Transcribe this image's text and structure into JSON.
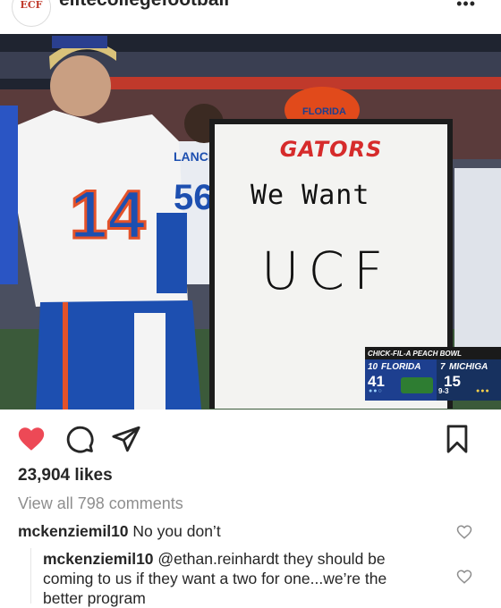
{
  "header": {
    "username": "elitecollegefootball",
    "avatar_text": "ECF",
    "more_icon": "more-horizontal-icon",
    "more_glyph": "•••"
  },
  "photo": {
    "whiteboard": {
      "header": "GATORS",
      "line1": "We Want",
      "line2": "UCF"
    },
    "jersey_number": "14",
    "background_player_name": "LANCE",
    "background_player_number": "56",
    "helmet_text": "FLORIDA",
    "score_bug": {
      "title": "CHICK-FIL-A PEACH BOWL",
      "team_left_rank": "10",
      "team_left": "FLORIDA",
      "score_left": "41",
      "team_right_rank": "7",
      "team_right": "MICHIGA",
      "score_right": "15",
      "quarter_info": "9-3",
      "dots_left": "●●○",
      "dots_right": "●●●"
    }
  },
  "actions": {
    "like_icon": "heart-filled-icon",
    "comment_icon": "comment-icon",
    "share_icon": "send-icon",
    "save_icon": "bookmark-icon",
    "like_color": "#ed4956"
  },
  "likes": "23,904 likes",
  "view_comments": "View all 798 comments",
  "comments": [
    {
      "user": "mckenziemil10",
      "text": "No you don’t"
    },
    {
      "user": "mckenziemil10",
      "mention": "@ethan.reinhardt",
      "text": "they should be coming to us if they want a two for one...we’re the better program"
    }
  ]
}
